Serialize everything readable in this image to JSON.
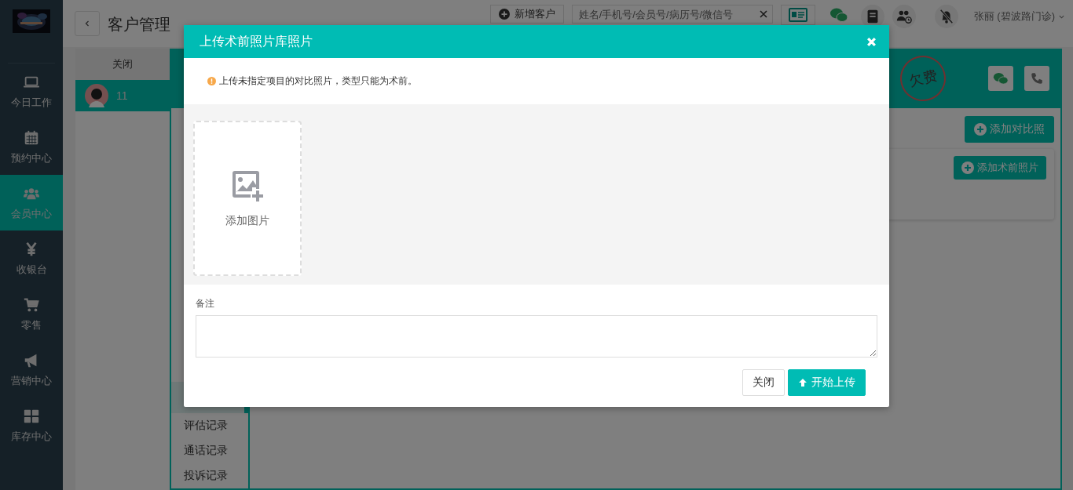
{
  "sidebar": {
    "items": [
      {
        "label": "今日工作",
        "selected": false
      },
      {
        "label": "预约中心",
        "selected": false
      },
      {
        "label": "会员中心",
        "selected": true
      },
      {
        "label": "收银台",
        "selected": false
      },
      {
        "label": "零售",
        "selected": false
      },
      {
        "label": "营销中心",
        "selected": false
      },
      {
        "label": "库存中心",
        "selected": false
      }
    ]
  },
  "header": {
    "title": "客户管理",
    "new_button": "新增客户",
    "search": {
      "placeholder": "姓名/手机号/会员号/病历号/微信号"
    },
    "user": "张丽 (碧波路门诊)"
  },
  "customer_list": {
    "close_label": "关闭",
    "rows": [
      {
        "name": "11",
        "selected": true
      }
    ]
  },
  "customer_panel": {
    "stamp": "欠费",
    "compare_button": "添加对比照",
    "pre_op_button": "添加术前照片",
    "tabs": [
      {
        "selected": true
      },
      {
        "label": "评估记录",
        "selected": false
      },
      {
        "label": "通话记录",
        "selected": false
      },
      {
        "label": "投诉记录",
        "selected": false
      }
    ]
  },
  "modal": {
    "title": "上传术前照片库照片",
    "notice": "上传未指定项目的对比照片，类型只能为术前。",
    "add_image": "添加图片",
    "remark_label": "备注",
    "buttons": [
      {
        "kind": "plain",
        "label": "关闭"
      },
      {
        "kind": "primary",
        "label": "开始上传"
      }
    ]
  }
}
